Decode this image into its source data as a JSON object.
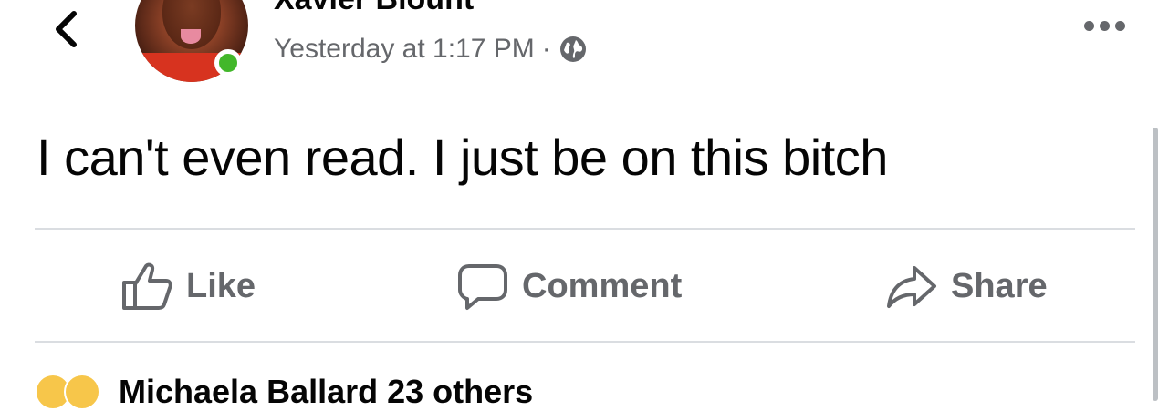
{
  "header": {
    "back_icon": "chevron-left-icon",
    "author_name": "Xavier Blount",
    "timestamp": "Yesterday at 1:17 PM",
    "separator": "·",
    "privacy_icon": "globe-icon",
    "more_icon": "more-horizontal-icon",
    "online_status_color": "#42b72a"
  },
  "post": {
    "text": "I can't even read. I just be on this bitch"
  },
  "actions": {
    "like_label": "Like",
    "comment_label": "Comment",
    "share_label": "Share"
  },
  "reactions": {
    "summary_text": "Michaela Ballard 23 others"
  },
  "colors": {
    "text_primary": "#050505",
    "text_secondary": "#65676b",
    "divider": "#dadde1"
  }
}
